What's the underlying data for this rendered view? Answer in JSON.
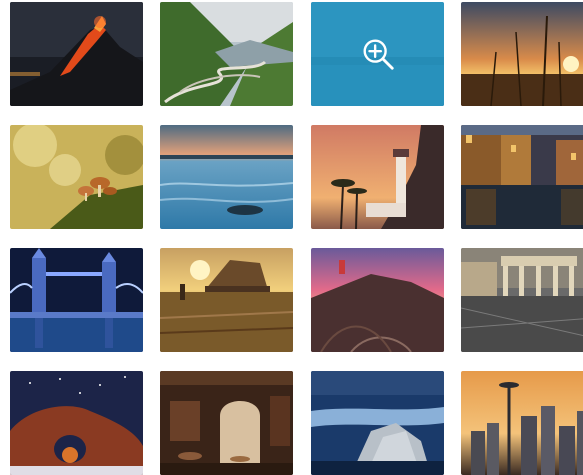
{
  "gallery": {
    "columns": 4,
    "rows": 4,
    "hover_icon": "zoom-in-icon",
    "overlay_color": "#2497c4",
    "images": [
      {
        "subject": "erupting-volcano-night"
      },
      {
        "subject": "winding-mountain-road"
      },
      {
        "subject": "lake-coast-hover"
      },
      {
        "subject": "grass-sunset"
      },
      {
        "subject": "mushrooms-bokeh"
      },
      {
        "subject": "sea-shore-dusk"
      },
      {
        "subject": "lighthouse-sunset"
      },
      {
        "subject": "canal-town-evening"
      },
      {
        "subject": "tower-bridge-night"
      },
      {
        "subject": "castle-ruins-sunrise"
      },
      {
        "subject": "lighthouse-hill-pink-sky"
      },
      {
        "subject": "brandenburg-gate"
      },
      {
        "subject": "starry-rock-arch"
      },
      {
        "subject": "cafe-courtyard"
      },
      {
        "subject": "mountain-clouds"
      },
      {
        "subject": "space-needle-skyline"
      }
    ]
  }
}
